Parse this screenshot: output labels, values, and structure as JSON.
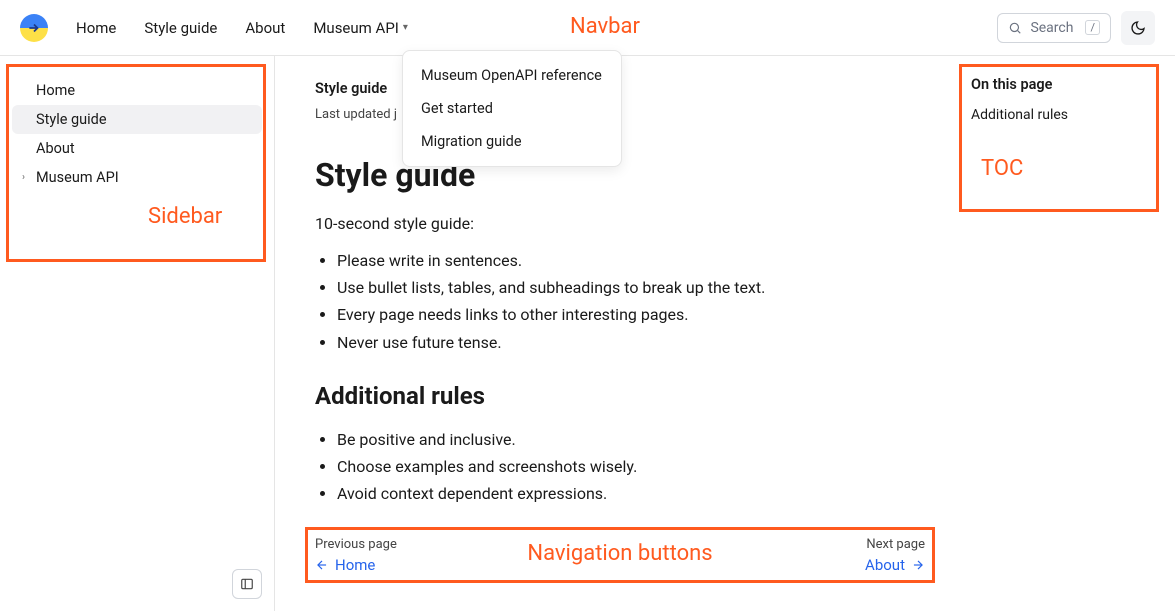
{
  "annotations": {
    "navbar": "Navbar",
    "sidebar": "Sidebar",
    "toc": "TOC",
    "navbuttons": "Navigation buttons"
  },
  "navbar": {
    "links": [
      "Home",
      "Style guide",
      "About",
      "Museum API"
    ],
    "search_placeholder": "Search",
    "search_key": "/"
  },
  "dropdown": {
    "items": [
      "Museum OpenAPI reference",
      "Get started",
      "Migration guide"
    ]
  },
  "sidebar": {
    "items": [
      {
        "label": "Home",
        "expandable": false,
        "active": false
      },
      {
        "label": "Style guide",
        "expandable": false,
        "active": true
      },
      {
        "label": "About",
        "expandable": false,
        "active": false
      },
      {
        "label": "Museum API",
        "expandable": true,
        "active": false
      }
    ]
  },
  "main": {
    "breadcrumb": "Style guide",
    "updated_prefix": "Last updated j",
    "h1": "Style guide",
    "intro": "10-second style guide:",
    "bullets1": [
      "Please write in sentences.",
      "Use bullet lists, tables, and subheadings to break up the text.",
      "Every page needs links to other interesting pages.",
      "Never use future tense."
    ],
    "h2": "Additional rules",
    "bullets2": [
      "Be positive and inclusive.",
      "Choose examples and screenshots wisely.",
      "Avoid context dependent expressions."
    ]
  },
  "pagenav": {
    "prev_label": "Previous page",
    "prev_link": "Home",
    "next_label": "Next page",
    "next_link": "About"
  },
  "toc": {
    "title": "On this page",
    "items": [
      "Additional rules"
    ]
  }
}
